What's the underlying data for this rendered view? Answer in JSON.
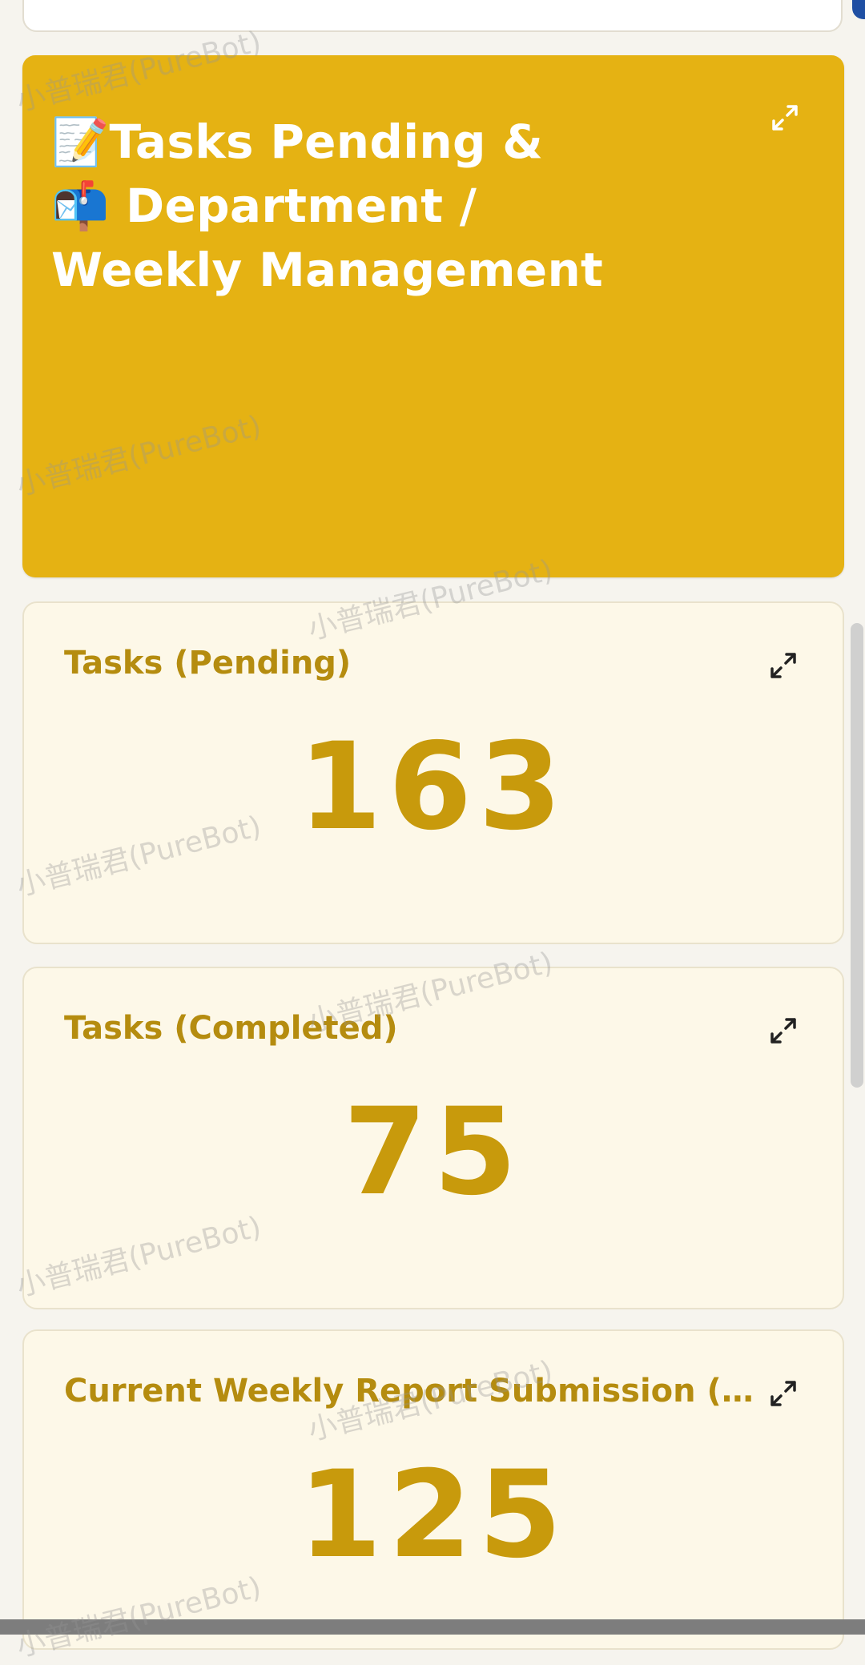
{
  "header_card": {
    "title": "📝Tasks Pending & 📬 Department / Weekly Management",
    "color": "#e5b213"
  },
  "cards": [
    {
      "label": "Tasks (Pending)",
      "value": "163"
    },
    {
      "label": "Tasks (Completed)",
      "value": "75"
    },
    {
      "label": "Current Weekly Report Submission (Count)",
      "value": "125"
    }
  ],
  "watermark": "小普瑞君(PureBot)",
  "icons": {
    "expand": "expand-arrows-icon"
  },
  "colors": {
    "label": "#b58c0f",
    "value": "#c89a0c",
    "card_bg": "#fdf8e8"
  }
}
